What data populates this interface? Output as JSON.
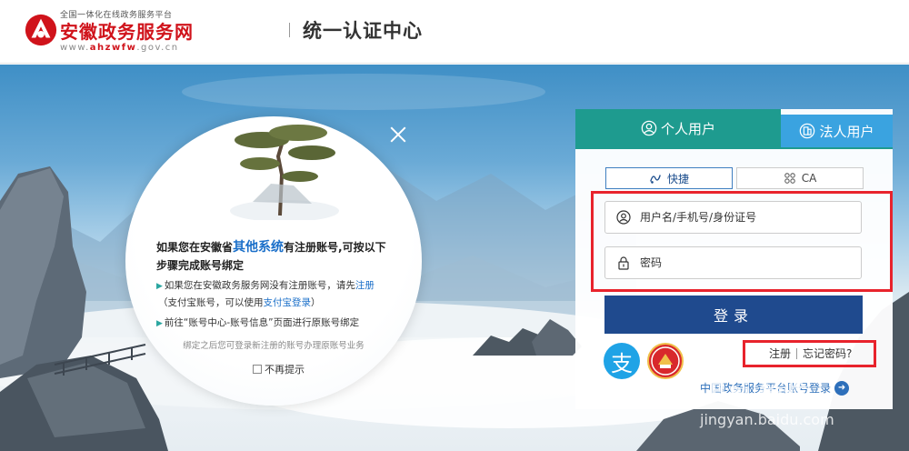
{
  "header": {
    "logo_sub": "全国一体化在线政务服务平台",
    "logo_main": "安徽政务服务网",
    "logo_url_prefix": "www.",
    "logo_url_bold": "ahzwfw",
    "logo_url_suffix": ".gov.cn",
    "title": "统一认证中心"
  },
  "popup": {
    "heading_pre": "如果您在安徽省",
    "heading_hl": "其他系统",
    "heading_post": "有注册账号,可按以下步骤完成账号绑定",
    "item1_pre": "如果您在安徽政务服务网没有注册账号，请先",
    "item1_link": "注册",
    "item1b_pre": "（支付宝账号，可以使用",
    "item1b_link": "支付宝登录",
    "item1b_post": "）",
    "item2": "前往“账号中心-账号信息”页面进行原账号绑定",
    "note": "绑定之后您可登录新注册的账号办理原账号业务",
    "checkbox_label": "不再提示"
  },
  "panel": {
    "tab_personal": "个人用户",
    "tab_legal": "法人用户",
    "mode_fast": "快捷",
    "mode_ca": "CA",
    "username_placeholder": "用户名/手机号/身份证号",
    "password_placeholder": "密码",
    "login_label": "登录",
    "alipay_glyph": "支",
    "register": "注册",
    "forgot": "忘记密码?",
    "national": "中国政务服务平台账号登录"
  },
  "watermark": {
    "line1": "Bai 经验",
    "line2": "jingyan.baidu.com"
  },
  "colors": {
    "brand_red": "#d0131b",
    "tab_green": "#1e9b8f",
    "tab_blue": "#3aa3e0",
    "button_navy": "#1f4a8e",
    "highlight_red": "#e8232c"
  }
}
